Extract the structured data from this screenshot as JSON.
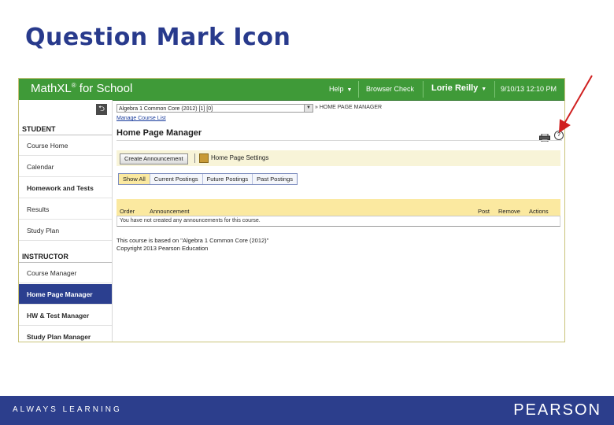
{
  "slide": {
    "title": "Question Mark Icon"
  },
  "app": {
    "logo_text": "MathXL",
    "logo_mark": "®",
    "logo_suffix": " for School",
    "help_label": "Help",
    "browser_check_label": "Browser Check",
    "user_name": "Lorie Reilly",
    "datetime": "9/10/13 12:10 PM"
  },
  "sidebar": {
    "student_heading": "STUDENT",
    "student_items": [
      "Course Home",
      "Calendar",
      "Homework and Tests",
      "Results",
      "Study Plan"
    ],
    "instructor_heading": "INSTRUCTOR",
    "instructor_items": [
      "Course Manager",
      "Home Page Manager",
      "HW & Test Manager",
      "Study Plan Manager"
    ],
    "active_item": "Home Page Manager"
  },
  "main": {
    "course_selected": "Algebra 1 Common Core (2012) [1] [0]",
    "breadcrumb": "» HOME PAGE MANAGER",
    "manage_course_list": "Manage Course List",
    "page_title": "Home Page Manager",
    "create_announcement": "Create Announcement",
    "home_page_settings": "Home Page Settings",
    "tabs": [
      "Show All",
      "Current Postings",
      "Future Postings",
      "Past Postings"
    ],
    "active_tab": "Show All",
    "table_headers": {
      "order": "Order",
      "announcement": "Announcement",
      "post": "Post",
      "remove": "Remove",
      "actions": "Actions"
    },
    "empty_row": "You have not created any announcements for this course.",
    "note_based_on": "This course is based on \"Algebra 1 Common Core (2012)\"",
    "note_copyright": "Copyright 2013 Pearson Education"
  },
  "icons": {
    "print": "printer-icon",
    "help": "question-mark-icon",
    "back": "back-arrow-icon",
    "settings": "settings-icon"
  },
  "footer": {
    "tagline": "ALWAYS LEARNING",
    "brand": "PEARSON"
  },
  "colors": {
    "title": "#283a8c",
    "topbar": "#3f9a38",
    "active_nav": "#2b3f8f",
    "table_header": "#fbe9a0",
    "footer": "#2c3e8c",
    "arrow": "#d02020"
  }
}
